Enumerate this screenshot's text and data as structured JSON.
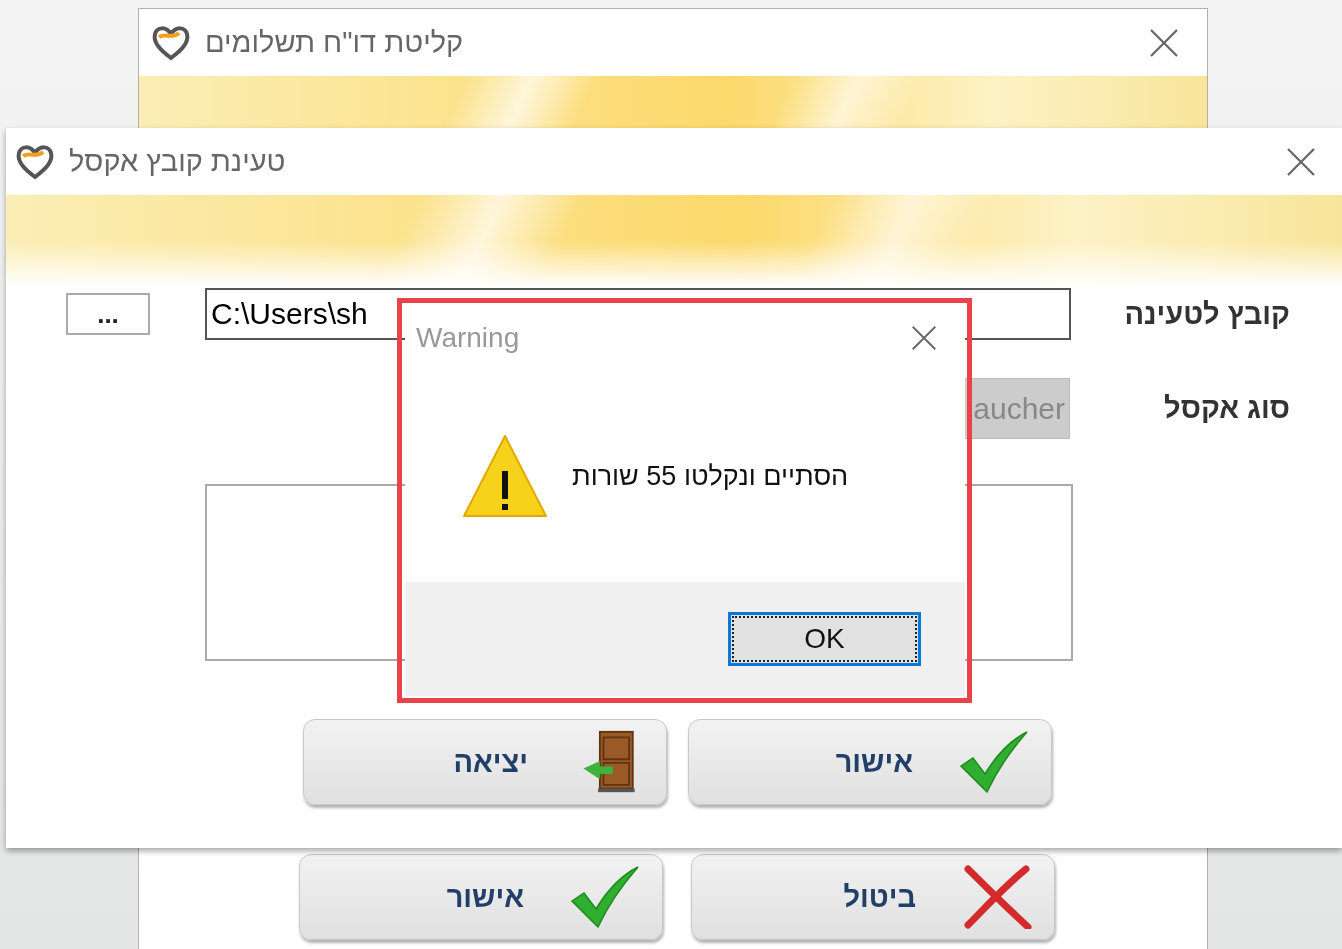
{
  "background_window": {
    "title": "קליטת דו\"ח תשלומים",
    "buttons": [
      {
        "label": "ביטול",
        "kind": "cancel"
      },
      {
        "label": "אישור",
        "kind": "check"
      }
    ]
  },
  "main_window": {
    "title": "טעינת קובץ אקסל",
    "file_label": "קובץ לטעינה",
    "file_path": "C:\\Users\\sh",
    "browse_button": "...",
    "excel_type_label": "סוג אקסל",
    "excel_type_value": "aucher",
    "buttons": [
      {
        "label": "אישור",
        "kind": "check"
      },
      {
        "label": "יציאה",
        "kind": "exit"
      }
    ]
  },
  "warning_dialog": {
    "title": "Warning",
    "message": "הסתיים ונקלטו 55 שורות",
    "ok_button": "OK"
  }
}
